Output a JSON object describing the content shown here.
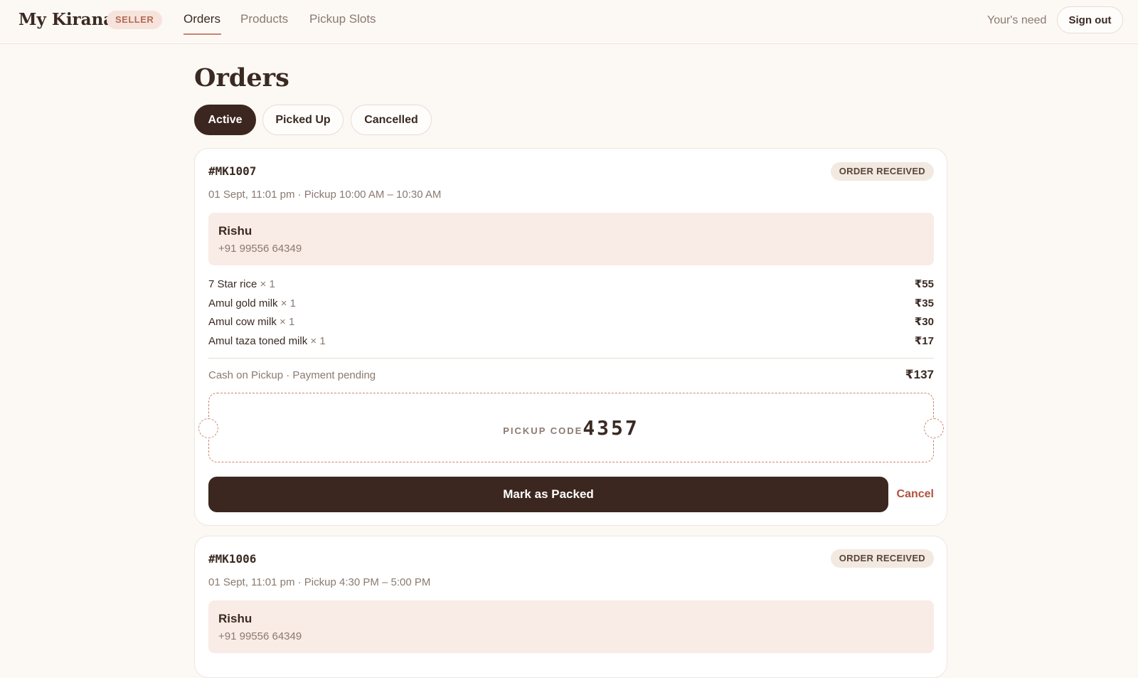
{
  "header": {
    "brand": "My Kirana",
    "badge": "SELLER",
    "nav": [
      {
        "label": "Orders",
        "active": true
      },
      {
        "label": "Products",
        "active": false
      },
      {
        "label": "Pickup Slots",
        "active": false
      }
    ],
    "tagline": "Your's need",
    "signout_label": "Sign out"
  },
  "page": {
    "title": "Orders",
    "filters": [
      {
        "label": "Active",
        "active": true
      },
      {
        "label": "Picked Up",
        "active": false
      },
      {
        "label": "Cancelled",
        "active": false
      }
    ]
  },
  "orders": [
    {
      "id": "#MK1007",
      "status": "ORDER RECEIVED",
      "meta": "01 Sept, 11:01 pm · Pickup 10:00 AM – 10:30 AM",
      "customer_name": "Rishu",
      "customer_phone": "+91 99556 64349",
      "items": [
        {
          "name": "7 Star rice",
          "qty": "× 1",
          "price": "₹55"
        },
        {
          "name": "Amul gold milk",
          "qty": "× 1",
          "price": "₹35"
        },
        {
          "name": "Amul cow milk",
          "qty": "× 1",
          "price": "₹30"
        },
        {
          "name": "Amul taza toned milk",
          "qty": "× 1",
          "price": "₹17"
        }
      ],
      "payment": "Cash on Pickup · Payment pending",
      "total": "₹137",
      "pickup_label": "PICKUP CODE",
      "pickup_code": "4357",
      "primary_action": "Mark as Packed",
      "cancel_label": "Cancel"
    },
    {
      "id": "#MK1006",
      "status": "ORDER RECEIVED",
      "meta": "01 Sept, 11:01 pm · Pickup 4:30 PM – 5:00 PM",
      "customer_name": "Rishu",
      "customer_phone": "+91 99556 64349"
    }
  ],
  "colors": {
    "background": "#fcf8f4",
    "primary_dark": "#3b271f",
    "accent": "#c9866e",
    "cancel": "#b0523d",
    "customer_bg": "#f9ebe6"
  }
}
